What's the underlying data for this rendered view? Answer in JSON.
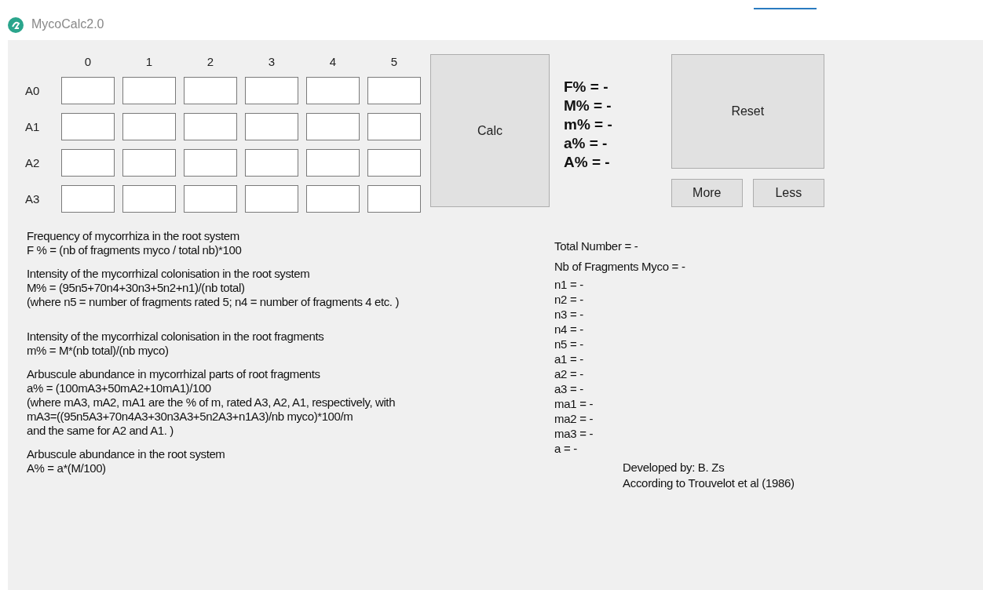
{
  "window": {
    "title": "MycoCalc2.0"
  },
  "grid": {
    "columns": [
      "0",
      "1",
      "2",
      "3",
      "4",
      "5"
    ],
    "rows": [
      {
        "label": "A0"
      },
      {
        "label": "A1"
      },
      {
        "label": "A2"
      },
      {
        "label": "A3"
      }
    ]
  },
  "calc_button": "Calc",
  "results": [
    "F% = -",
    "M% = -",
    "m% = -",
    "a% = -",
    "A% = -"
  ],
  "reset_button": "Reset",
  "more_button": "More",
  "less_button": "Less",
  "descriptions": [
    {
      "lines": [
        "Frequency of mycorrhiza in the root system",
        "F % = (nb of fragments myco / total nb)*100"
      ]
    },
    {
      "lines": [
        "Intensity of the mycorrhizal colonisation in the root system",
        "M% = (95n5+70n4+30n3+5n2+n1)/(nb total)",
        "(where n5 = number of fragments rated 5; n4 = number of fragments 4 etc. )"
      ]
    },
    {
      "lines": [
        "Intensity of the mycorrhizal colonisation in the root fragments",
        "m% = M*(nb total)/(nb myco)"
      ]
    },
    {
      "lines": [
        "Arbuscule abundance in mycorrhizal parts of root fragments",
        "a% = (100mA3+50mA2+10mA1)/100",
        "(where mA3, mA2, mA1 are the % of m, rated A3, A2, A1, respectively, with",
        "mA3=((95n5A3+70n4A3+30n3A3+5n2A3+n1A3)/nb myco)*100/m",
        "and the same for A2 and A1. )"
      ]
    },
    {
      "lines": [
        "Arbuscule abundance in the root system",
        "A% = a*(M/100)"
      ]
    }
  ],
  "stats": [
    "Total Number = -",
    "Nb of Fragments Myco = -",
    "n1 = -",
    "n2 = -",
    "n3 = -",
    "n4 = -",
    "n5 = -",
    "a1 = -",
    "a2 = -",
    "a3 = -",
    "ma1 = -",
    "ma2 = -",
    "ma3 = -",
    "a = -"
  ],
  "credits": [
    "Developed by: B. Zs",
    "According to Trouvelot et al (1986)"
  ]
}
